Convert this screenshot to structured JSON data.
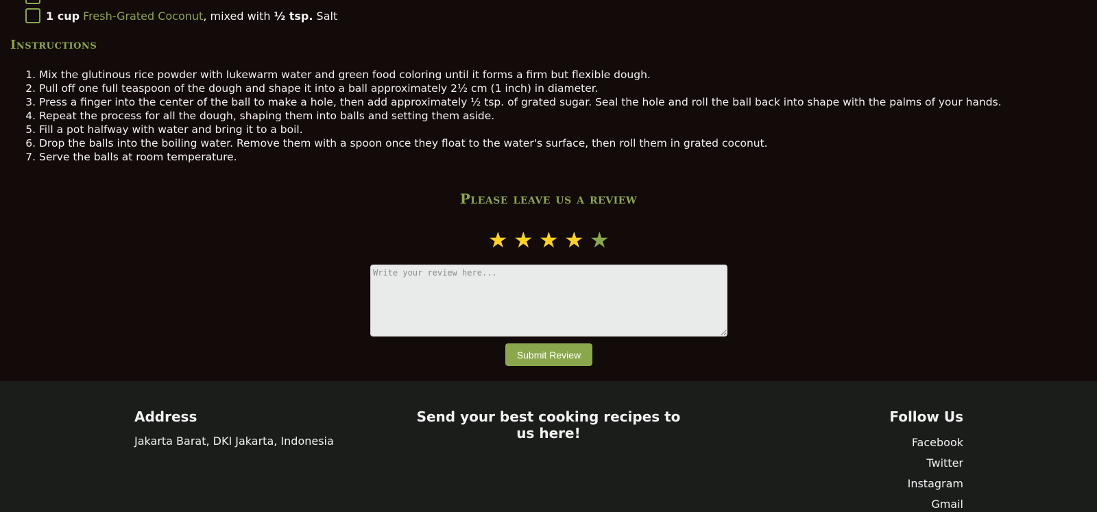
{
  "ingredients": [
    {
      "amount": "1 cup",
      "item": "Fresh-Grated Coconut",
      "connector": ", mixed with ",
      "amount2": "½ tsp.",
      "item2": " Salt"
    }
  ],
  "instructions": {
    "title": "Instructions",
    "steps": [
      "Mix the glutinous rice powder with lukewarm water and green food coloring until it forms a firm but flexible dough.",
      "Pull off one full teaspoon of the dough and shape it into a ball approximately 2½ cm (1 inch) in diameter.",
      "Press a finger into the center of the ball to make a hole, then add approximately ½ tsp. of grated sugar. Seal the hole and roll the ball back into shape with the palms of your hands.",
      "Repeat the process for all the dough, shaping them into balls and setting them aside.",
      "Fill a pot halfway with water and bring it to a boil.",
      "Drop the balls into the boiling water. Remove them with a spoon once they float to the water's surface, then roll them in grated coconut.",
      "Serve the balls at room temperature."
    ]
  },
  "review": {
    "title": "Please leave us a review",
    "rating": 4,
    "max_rating": 5,
    "star_glyph": "★",
    "star_on_color": "#ffd21f",
    "star_off_color": "#8aa84b",
    "placeholder": "Write your review here...",
    "submit_label": "Submit Review"
  },
  "footer": {
    "address": {
      "heading": "Address",
      "text": "Jakarta Barat, DKI Jakarta, Indonesia"
    },
    "send": {
      "heading": "Send your best cooking recipes to us here!"
    },
    "follow": {
      "heading": "Follow Us",
      "links": [
        "Facebook",
        "Twitter",
        "Instagram",
        "Gmail"
      ]
    }
  },
  "colors": {
    "background": "#130a0a",
    "accent": "#8aa84b",
    "footer_bg": "#1b1d1b"
  }
}
